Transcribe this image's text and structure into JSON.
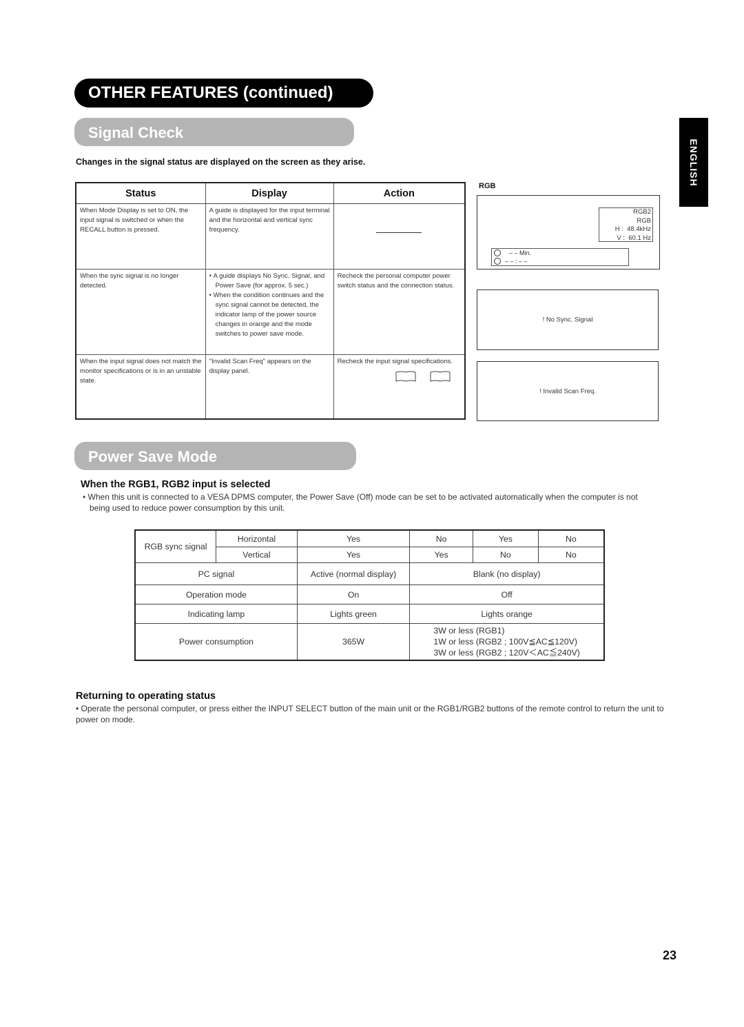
{
  "header": {
    "section_title": "OTHER FEATURES (continued)",
    "language_tab": "ENGLISH"
  },
  "signal_check": {
    "title": "Signal Check",
    "intro": "Changes in the signal status are displayed on the screen as they arise.",
    "table": {
      "headers": [
        "Status",
        "Display",
        "Action"
      ],
      "rows": [
        {
          "status": "When Mode Display is set to ON, the input signal is switched or when the RECALL button is pressed.",
          "display": [
            "A guide is displayed for the input terminal and the horizontal and vertical sync frequency."
          ],
          "action": ""
        },
        {
          "status": "When the sync signal is no longer detected.",
          "display": [
            "A guide displays No Sync. Signal, and Power Save (for approx. 5 sec.)",
            "When the condition continues and the sync signal cannot be detected, the indicator lamp of the power source changes in orange and the mode switches to power save mode."
          ],
          "action": "Recheck the personal computer power switch status and the connection status."
        },
        {
          "status": "When the input signal does not match the monitor specifications or is in an unstable state.",
          "display": [
            "\"Invalid Scan Freq\" appears on the display panel."
          ],
          "action": "Recheck the input signal specifications."
        }
      ]
    },
    "screens": {
      "label": "RGB",
      "guide": {
        "input_terminal": "RGB2",
        "signal": "RGB",
        "h_label": "H :",
        "h_value": "48.4kHz",
        "v_label": "V :",
        "v_value": "60.1  Hz",
        "off_timer": "– –  Min.",
        "clock": "– – : – –"
      },
      "no_sync": "! No Sync. Signal",
      "invalid_freq": "! Invalid Scan Freq."
    }
  },
  "power_save": {
    "title": "Power Save Mode",
    "subheading": "When the RGB1, RGB2 input is selected",
    "description": "When this unit is connected to a VESA DPMS computer, the Power Save (Off) mode can be set to be activated automatically when the computer is not being used to reduce power consumption by this unit.",
    "table": {
      "sync_label": "RGB sync signal",
      "horizontal_label": "Horizontal",
      "vertical_label": "Vertical",
      "horizontal": [
        "Yes",
        "No",
        "Yes",
        "No"
      ],
      "vertical": [
        "Yes",
        "Yes",
        "No",
        "No"
      ],
      "pc_signal": {
        "label": "PC signal",
        "active": "Active (normal display)",
        "blank": "Blank (no display)"
      },
      "operation_mode": {
        "label": "Operation mode",
        "active": "On",
        "blank": "Off"
      },
      "indicating_lamp": {
        "label": "Indicating lamp",
        "active": "Lights green",
        "blank": "Lights orange"
      },
      "power_consumption": {
        "label": "Power consumption",
        "active": "365W",
        "blank": [
          "3W or less (RGB1)",
          "1W or less (RGB2 ; 100V≦AC≦120V)",
          "3W or less (RGB2 ; 120V＜AC≦240V)"
        ]
      }
    },
    "returning": {
      "heading": "Returning to operating status",
      "text": "• Operate the personal computer, or press either the INPUT SELECT button of the main unit or the RGB1/RGB2 buttons of the remote control to return the unit to power on mode."
    }
  },
  "footer": {
    "page_number": "23"
  }
}
